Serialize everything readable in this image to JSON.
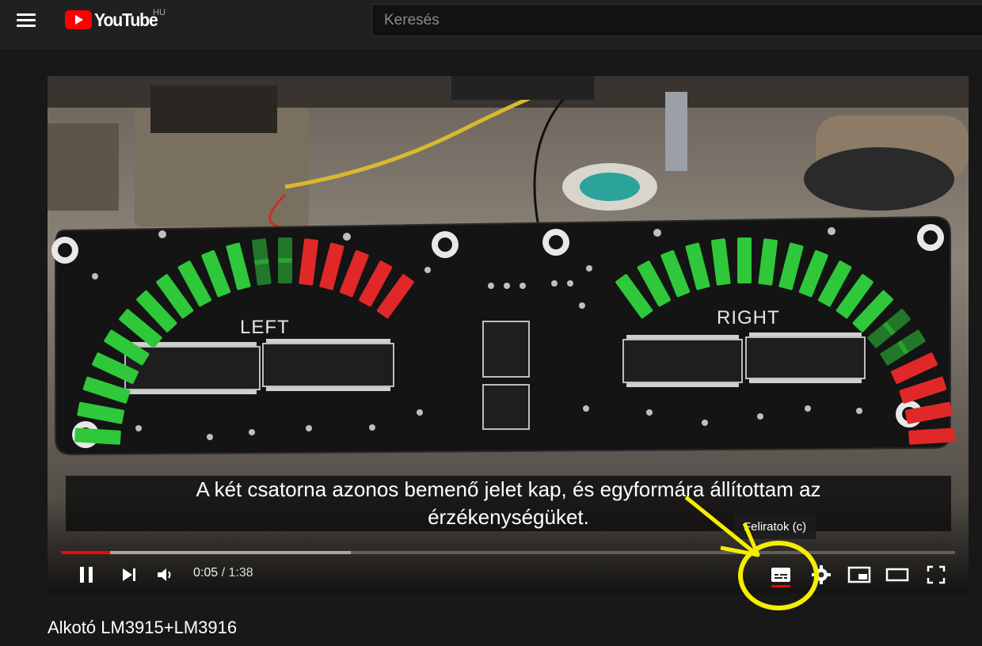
{
  "header": {
    "logo_text": "YouTube",
    "country_code": "HU",
    "search_placeholder": "Keresés"
  },
  "player": {
    "caption_line1": "A két csatorna azonos bemenő jelet kap, és egyformára állítottam az",
    "caption_line2": "érzékenységüket.",
    "tooltip": "Feliratok (c)",
    "current_time": "0:05",
    "time_separator": " / ",
    "duration": "1:38",
    "progress_played": 0.055,
    "progress_buffered": 0.324,
    "board_label_left": "LEFT",
    "board_label_right": "RIGHT",
    "controls": [
      "pause-icon",
      "next-icon",
      "volume-icon",
      "subtitles-icon",
      "settings-icon",
      "miniplayer-icon",
      "theater-icon",
      "fullscreen-icon"
    ]
  },
  "video": {
    "title": "Alkotó LM3915+LM3916"
  },
  "colors": {
    "brand_red": "#ff0000",
    "annotation_yellow": "#f5ee00",
    "led_green": "#2ec83a",
    "led_red": "#e02828"
  }
}
